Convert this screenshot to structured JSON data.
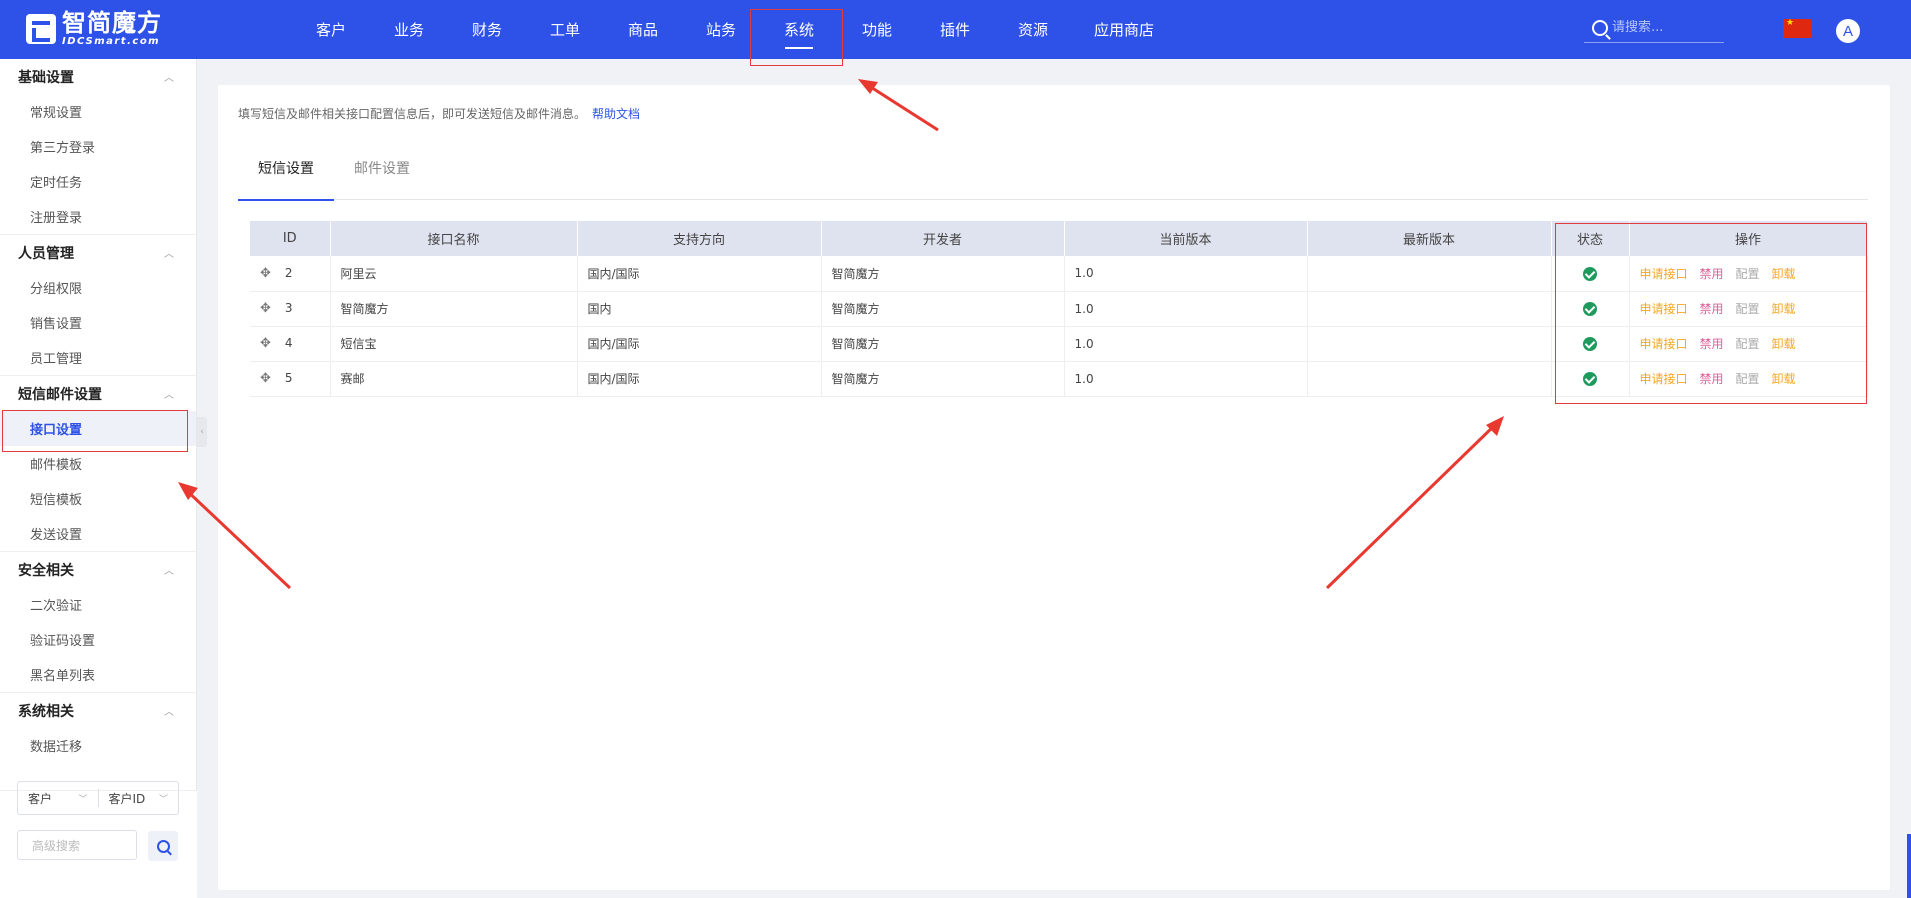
{
  "app": {
    "logo_cn": "智简魔方",
    "logo_en": "IDCSmart.com"
  },
  "nav": {
    "items": [
      "客户",
      "业务",
      "财务",
      "工单",
      "商品",
      "站务",
      "系统",
      "功能",
      "插件",
      "资源",
      "应用商店"
    ],
    "active": "系统"
  },
  "search": {
    "placeholder": "请搜索..."
  },
  "avatar": {
    "letter": "A"
  },
  "sidebar": {
    "groups": [
      {
        "title": "基础设置",
        "items": [
          "常规设置",
          "第三方登录",
          "定时任务",
          "注册登录"
        ]
      },
      {
        "title": "人员管理",
        "items": [
          "分组权限",
          "销售设置",
          "员工管理"
        ]
      },
      {
        "title": "短信邮件设置",
        "items": [
          "接口设置",
          "邮件模板",
          "短信模板",
          "发送设置"
        ]
      },
      {
        "title": "安全相关",
        "items": [
          "二次验证",
          "验证码设置",
          "黑名单列表"
        ]
      },
      {
        "title": "系统相关",
        "items": [
          "数据迁移"
        ]
      }
    ],
    "active_item": "接口设置",
    "filter": {
      "type": "客户",
      "field": "客户ID"
    },
    "advanced_search_placeholder": "高级搜索"
  },
  "main": {
    "notice": "填写短信及邮件相关接口配置信息后，即可发送短信及邮件消息。",
    "help_link": "帮助文档",
    "tabs": [
      "短信设置",
      "邮件设置"
    ],
    "active_tab": "短信设置",
    "table": {
      "headers": [
        "ID",
        "接口名称",
        "支持方向",
        "开发者",
        "当前版本",
        "最新版本",
        "状态",
        "操作"
      ],
      "rows": [
        {
          "id": "2",
          "name": "阿里云",
          "direction": "国内/国际",
          "developer": "智简魔方",
          "version": "1.0",
          "latest": "",
          "status": "enabled"
        },
        {
          "id": "3",
          "name": "智简魔方",
          "direction": "国内",
          "developer": "智简魔方",
          "version": "1.0",
          "latest": "",
          "status": "enabled"
        },
        {
          "id": "4",
          "name": "短信宝",
          "direction": "国内/国际",
          "developer": "智简魔方",
          "version": "1.0",
          "latest": "",
          "status": "enabled"
        },
        {
          "id": "5",
          "name": "赛邮",
          "direction": "国内/国际",
          "developer": "智简魔方",
          "version": "1.0",
          "latest": "",
          "status": "enabled"
        }
      ],
      "actions": [
        "申请接口",
        "禁用",
        "配置",
        "卸载"
      ]
    }
  },
  "colors": {
    "brand": "#2e52e8",
    "highlight": "#e03c3c",
    "action_orange": "#f5a623",
    "action_pink": "#e0609a",
    "status_green": "#1e9b5c"
  }
}
